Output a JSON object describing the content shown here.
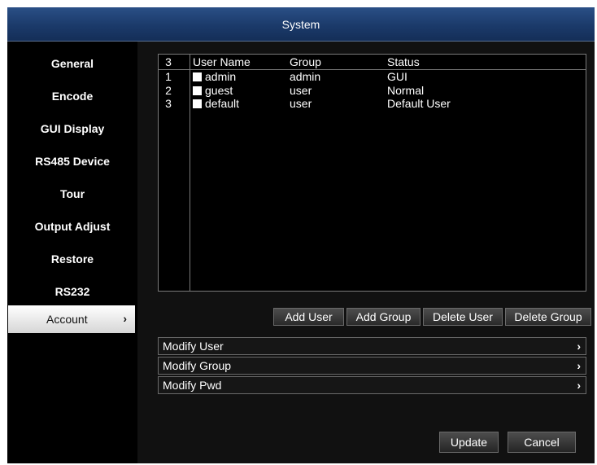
{
  "window": {
    "title": "System"
  },
  "sidebar": {
    "items": [
      {
        "label": "General"
      },
      {
        "label": "Encode"
      },
      {
        "label": "GUI Display"
      },
      {
        "label": "RS485 Device"
      },
      {
        "label": "Tour"
      },
      {
        "label": "Output Adjust"
      },
      {
        "label": "Restore"
      },
      {
        "label": "RS232"
      },
      {
        "label": "Account",
        "active": true,
        "chevron": "›"
      }
    ]
  },
  "user_table": {
    "count": "3",
    "columns": [
      "User Name",
      "Group",
      "Status"
    ],
    "rows": [
      {
        "num": "1",
        "user": "admin",
        "group": "admin",
        "status": "GUI"
      },
      {
        "num": "2",
        "user": "guest",
        "group": "user",
        "status": "Normal"
      },
      {
        "num": "3",
        "user": "default",
        "group": "user",
        "status": "Default User"
      }
    ]
  },
  "actions": {
    "add_user": "Add User",
    "add_group": "Add Group",
    "delete_user": "Delete User",
    "delete_group": "Delete Group"
  },
  "options": [
    {
      "label": "Modify User",
      "chevron": "›"
    },
    {
      "label": "Modify Group",
      "chevron": "›"
    },
    {
      "label": "Modify Pwd",
      "chevron": "›"
    }
  ],
  "footer": {
    "update": "Update",
    "cancel": "Cancel"
  },
  "colors": {
    "title_bar": "#1b3a6a",
    "background": "#000000",
    "active_item": "#e6e6e6"
  }
}
